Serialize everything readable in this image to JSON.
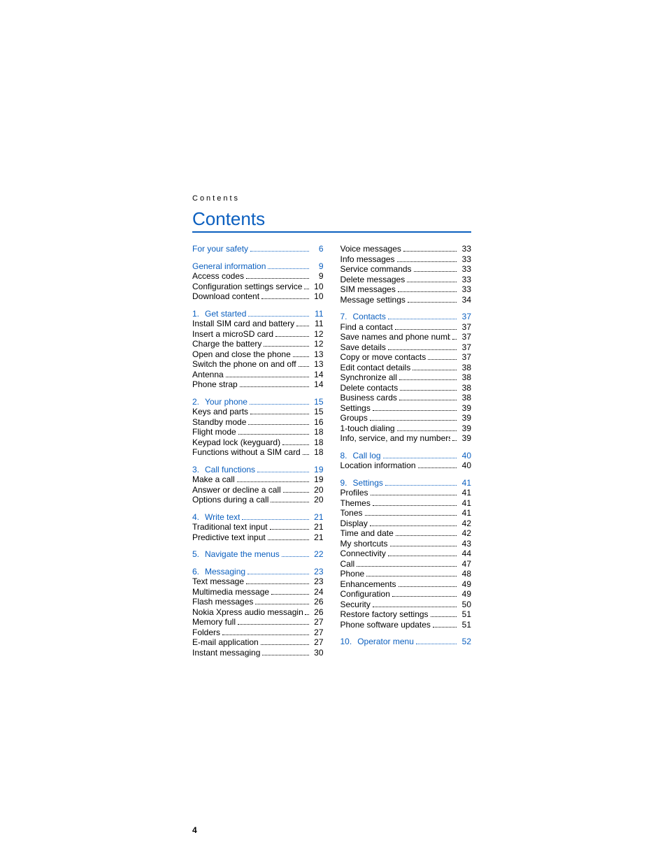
{
  "running_head": "Contents",
  "title": "Contents",
  "page_number": "4",
  "left_column": [
    {
      "type": "section",
      "num": "",
      "label": "For your safety",
      "page": "6",
      "items": []
    },
    {
      "type": "section",
      "num": "",
      "label": "General information",
      "page": "9",
      "items": [
        {
          "label": "Access codes",
          "page": "9"
        },
        {
          "label": "Configuration settings service",
          "page": "10"
        },
        {
          "label": "Download content",
          "page": "10"
        }
      ]
    },
    {
      "type": "section",
      "num": "1.",
      "label": "Get started",
      "page": "11",
      "items": [
        {
          "label": "Install SIM card and battery",
          "page": "11"
        },
        {
          "label": "Insert a microSD card",
          "page": "12"
        },
        {
          "label": "Charge the battery",
          "page": "12"
        },
        {
          "label": "Open and close the phone",
          "page": "13"
        },
        {
          "label": "Switch the phone on and off",
          "page": "13"
        },
        {
          "label": "Antenna",
          "page": "14"
        },
        {
          "label": "Phone strap",
          "page": "14"
        }
      ]
    },
    {
      "type": "section",
      "num": "2.",
      "label": "Your phone",
      "page": "15",
      "items": [
        {
          "label": "Keys and parts",
          "page": "15"
        },
        {
          "label": "Standby mode",
          "page": "16"
        },
        {
          "label": "Flight mode",
          "page": "18"
        },
        {
          "label": "Keypad lock (keyguard)",
          "page": "18"
        },
        {
          "label": "Functions without a SIM card",
          "page": "18"
        }
      ]
    },
    {
      "type": "section",
      "num": "3.",
      "label": "Call functions",
      "page": "19",
      "items": [
        {
          "label": "Make a call",
          "page": "19"
        },
        {
          "label": "Answer or decline a call",
          "page": "20"
        },
        {
          "label": "Options during a call",
          "page": "20"
        }
      ]
    },
    {
      "type": "section",
      "num": "4.",
      "label": "Write text",
      "page": "21",
      "items": [
        {
          "label": "Traditional text input",
          "page": "21"
        },
        {
          "label": "Predictive text input",
          "page": "21"
        }
      ]
    },
    {
      "type": "section",
      "num": "5.",
      "label": "Navigate the menus",
      "page": "22",
      "items": []
    },
    {
      "type": "section",
      "num": "6.",
      "label": "Messaging",
      "page": "23",
      "items": [
        {
          "label": "Text message",
          "page": "23"
        },
        {
          "label": "Multimedia message",
          "page": "24"
        },
        {
          "label": "Flash messages",
          "page": "26"
        },
        {
          "label": "Nokia Xpress audio messaging",
          "page": "26"
        },
        {
          "label": "Memory full",
          "page": "27"
        },
        {
          "label": "Folders",
          "page": "27"
        },
        {
          "label": "E-mail application",
          "page": "27"
        },
        {
          "label": "Instant messaging",
          "page": "30"
        }
      ]
    }
  ],
  "right_column": [
    {
      "type": "continuation",
      "items": [
        {
          "label": "Voice messages",
          "page": "33"
        },
        {
          "label": "Info messages",
          "page": "33"
        },
        {
          "label": "Service commands",
          "page": "33"
        },
        {
          "label": "Delete messages",
          "page": "33"
        },
        {
          "label": "SIM messages",
          "page": "33"
        },
        {
          "label": "Message settings",
          "page": "34"
        }
      ]
    },
    {
      "type": "section",
      "num": "7.",
      "label": "Contacts",
      "page": "37",
      "items": [
        {
          "label": "Find a contact",
          "page": "37"
        },
        {
          "label": "Save names and phone numbers",
          "page": "37"
        },
        {
          "label": "Save details",
          "page": "37"
        },
        {
          "label": "Copy or move contacts",
          "page": "37"
        },
        {
          "label": "Edit contact details",
          "page": "38"
        },
        {
          "label": "Synchronize all",
          "page": "38"
        },
        {
          "label": "Delete contacts",
          "page": "38"
        },
        {
          "label": "Business cards",
          "page": "38"
        },
        {
          "label": "Settings",
          "page": "39"
        },
        {
          "label": "Groups",
          "page": "39"
        },
        {
          "label": "1-touch dialing",
          "page": "39"
        },
        {
          "label": "Info, service, and my numbers",
          "page": "39"
        }
      ]
    },
    {
      "type": "section",
      "num": "8.",
      "label": "Call log",
      "page": "40",
      "items": [
        {
          "label": "Location information",
          "page": "40"
        }
      ]
    },
    {
      "type": "section",
      "num": "9.",
      "label": "Settings",
      "page": "41",
      "items": [
        {
          "label": "Profiles",
          "page": "41"
        },
        {
          "label": "Themes",
          "page": "41"
        },
        {
          "label": "Tones",
          "page": "41"
        },
        {
          "label": "Display",
          "page": "42"
        },
        {
          "label": "Time and date",
          "page": "42"
        },
        {
          "label": "My shortcuts",
          "page": "43"
        },
        {
          "label": "Connectivity",
          "page": "44"
        },
        {
          "label": "Call",
          "page": "47"
        },
        {
          "label": "Phone",
          "page": "48"
        },
        {
          "label": "Enhancements",
          "page": "49"
        },
        {
          "label": "Configuration",
          "page": "49"
        },
        {
          "label": "Security",
          "page": "50"
        },
        {
          "label": "Restore factory settings",
          "page": "51"
        },
        {
          "label": "Phone software updates",
          "page": "51"
        }
      ]
    },
    {
      "type": "section",
      "num": "10.",
      "label": "Operator menu",
      "page": "52",
      "items": []
    }
  ]
}
